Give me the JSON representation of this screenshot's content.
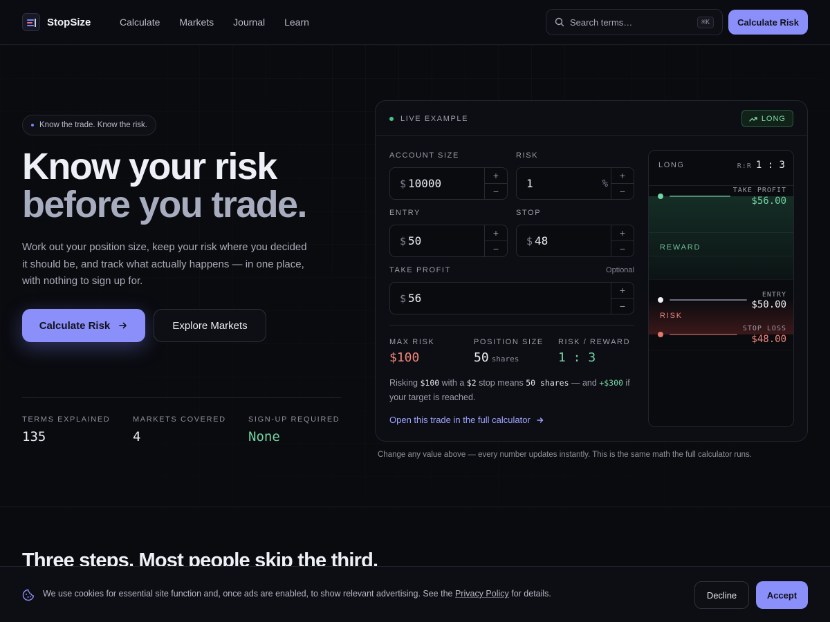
{
  "header": {
    "brand": "StopSize",
    "nav": [
      "Calculate",
      "Markets",
      "Journal",
      "Learn"
    ],
    "search_placeholder": "Search terms…",
    "search_shortcut": "⌘K",
    "cta": "Calculate Risk"
  },
  "hero": {
    "pill": "Know the trade. Know the risk.",
    "headline_line1": "Know your risk",
    "headline_line2": "before you trade.",
    "lede": "Work out your position size, keep your risk where you decided it should be, and track what actually happens — in one place, with nothing to sign up for.",
    "primary_cta": "Calculate Risk",
    "secondary_cta": "Explore Markets",
    "stats": [
      {
        "label": "TERMS EXPLAINED",
        "value": "135"
      },
      {
        "label": "MARKETS COVERED",
        "value": "4"
      },
      {
        "label": "SIGN-UP REQUIRED",
        "value": "None"
      }
    ]
  },
  "calculator": {
    "live_label": "LIVE EXAMPLE",
    "direction_badge": "LONG",
    "fields": {
      "account_size": {
        "label": "ACCOUNT SIZE",
        "prefix": "$",
        "value": "10000"
      },
      "risk": {
        "label": "RISK",
        "suffix": "%",
        "value": "1"
      },
      "entry": {
        "label": "ENTRY",
        "prefix": "$",
        "value": "50"
      },
      "stop": {
        "label": "STOP",
        "prefix": "$",
        "value": "48"
      },
      "take_profit": {
        "label": "TAKE PROFIT",
        "prefix": "$",
        "value": "56",
        "optional_label": "Optional"
      }
    },
    "stepper_plus": "+",
    "stepper_minus": "−",
    "results": {
      "max_risk": {
        "label": "MAX RISK",
        "value": "$100"
      },
      "position_size": {
        "label": "POSITION SIZE",
        "value": "50",
        "unit": "shares"
      },
      "risk_reward": {
        "label": "RISK / REWARD",
        "value": "1 : 3"
      }
    },
    "explain": {
      "t1": "Risking ",
      "v1": "$100",
      "t2": " with a ",
      "v2": "$2",
      "t3": " stop means ",
      "v3": "50 shares",
      "t4": " — and ",
      "v4": "+$300",
      "t5": " if your target is reached."
    },
    "open_link": "Open this trade in the full calculator",
    "chart": {
      "direction": "LONG",
      "rr_key": "R:R",
      "rr_value": "1 : 3",
      "take_profit": {
        "label": "TAKE PROFIT",
        "price": "$56.00"
      },
      "reward_label": "REWARD",
      "entry": {
        "label": "ENTRY",
        "price": "$50.00"
      },
      "risk_label": "RISK",
      "stop_loss": {
        "label": "STOP LOSS",
        "price": "$48.00"
      }
    },
    "note": "Change any value above — every number updates instantly. This is the same math the full calculator runs."
  },
  "section": {
    "title": "Three steps. Most people skip the third."
  },
  "cookie": {
    "text_before": "We use cookies for essential site function and, once ads are enabled, to show relevant advertising. See the ",
    "link": "Privacy Policy",
    "text_after": " for details.",
    "decline": "Decline",
    "accept": "Accept"
  },
  "colors": {
    "accent": "#8b8ffa",
    "reward_green": "#74d3a4",
    "risk_red": "#f2867b",
    "background": "#0a0b0f"
  }
}
